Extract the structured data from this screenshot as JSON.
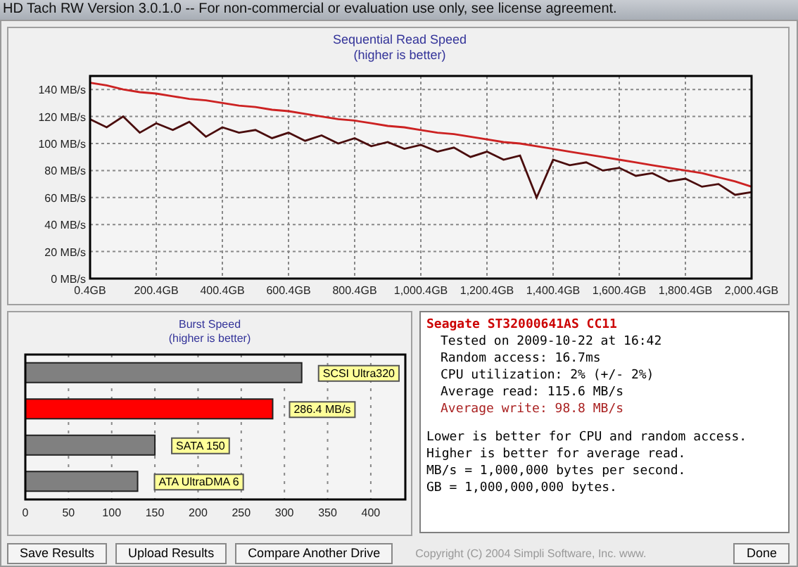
{
  "window": {
    "title": "HD Tach RW Version 3.0.1.0 -- For non-commercial or evaluation use only, see license agreement."
  },
  "sequential_chart": {
    "chart_data": {
      "type": "line",
      "title": "Sequential Read Speed",
      "subtitle": "(higher is better)",
      "x": [
        0.4,
        50.4,
        100.4,
        150.4,
        200.4,
        250.4,
        300.4,
        350.4,
        400.4,
        450.4,
        500.4,
        550.4,
        600.4,
        650.4,
        700.4,
        750.4,
        800.4,
        850.4,
        900.4,
        950.4,
        1000.4,
        1050.4,
        1100.4,
        1150.4,
        1200.4,
        1250.4,
        1300.4,
        1350.4,
        1400.4,
        1450.4,
        1500.4,
        1550.4,
        1600.4,
        1650.4,
        1700.4,
        1750.4,
        1800.4,
        1850.4,
        1900.4,
        1950.4,
        2000.4
      ],
      "series": [
        {
          "color": "#cc2222",
          "values": [
            145,
            143,
            140,
            138,
            137,
            135,
            133,
            132,
            130,
            128,
            127,
            125,
            124,
            122,
            120,
            118,
            117,
            115,
            113,
            112,
            110,
            108,
            107,
            105,
            103,
            101,
            100,
            98,
            96,
            94,
            92,
            90,
            88,
            86,
            84,
            82,
            80,
            78,
            75,
            72,
            68
          ]
        },
        {
          "color": "#4a0d0d",
          "values": [
            118,
            112,
            120,
            108,
            115,
            110,
            116,
            105,
            112,
            108,
            110,
            104,
            108,
            102,
            106,
            100,
            104,
            98,
            101,
            96,
            99,
            94,
            97,
            90,
            94,
            88,
            91,
            60,
            88,
            84,
            86,
            80,
            82,
            76,
            78,
            72,
            74,
            68,
            70,
            62,
            64
          ]
        }
      ],
      "xlim": [
        0.4,
        2000.4
      ],
      "ylim": [
        0,
        150
      ],
      "grid": true,
      "xticks": [
        {
          "value": 0.4,
          "label": "0.4GB"
        },
        {
          "value": 200.4,
          "label": "200.4GB"
        },
        {
          "value": 400.4,
          "label": "400.4GB"
        },
        {
          "value": 600.4,
          "label": "600.4GB"
        },
        {
          "value": 800.4,
          "label": "800.4GB"
        },
        {
          "value": 1000.4,
          "label": "1,000.4GB"
        },
        {
          "value": 1200.4,
          "label": "1,200.4GB"
        },
        {
          "value": 1400.4,
          "label": "1,400.4GB"
        },
        {
          "value": 1600.4,
          "label": "1,600.4GB"
        },
        {
          "value": 1800.4,
          "label": "1,800.4GB"
        },
        {
          "value": 2000.4,
          "label": "2,000.4GB"
        }
      ],
      "yticks": [
        {
          "value": 0,
          "label": "0 MB/s"
        },
        {
          "value": 20,
          "label": "20 MB/s"
        },
        {
          "value": 40,
          "label": "40 MB/s"
        },
        {
          "value": 60,
          "label": "60 MB/s"
        },
        {
          "value": 80,
          "label": "80 MB/s"
        },
        {
          "value": 100,
          "label": "100 MB/s"
        },
        {
          "value": 120,
          "label": "120 MB/s"
        },
        {
          "value": 140,
          "label": "140 MB/s"
        }
      ]
    }
  },
  "burst_chart": {
    "chart_data": {
      "type": "bar",
      "orientation": "horizontal",
      "title": "Burst Speed",
      "subtitle": "(higher is better)",
      "categories": [
        "SCSI Ultra320",
        "286.4 MB/s",
        "SATA 150",
        "ATA UltraDMA 6"
      ],
      "series": [
        {
          "color": "#808080",
          "values": [
            320,
            null,
            150,
            130
          ]
        },
        {
          "color": "#ff0000",
          "values": [
            null,
            286.4,
            null,
            null
          ]
        }
      ],
      "xlim": [
        0,
        440
      ],
      "grid": true,
      "xticks": [
        0,
        50,
        100,
        150,
        200,
        250,
        300,
        350,
        400
      ]
    }
  },
  "results": {
    "lines": [
      {
        "text": "Seagate ST32000641AS CC11",
        "color": "#cc0000",
        "bold": true
      },
      {
        "text": "Tested on 2009-10-22 at 16:42",
        "color": "#000000",
        "bold": false
      },
      {
        "text": "Random access: 16.7ms",
        "color": "#000000",
        "bold": false
      },
      {
        "text": "CPU utilization: 2% (+/- 2%)",
        "color": "#000000",
        "bold": false
      },
      {
        "text": "Average read: 115.6 MB/s",
        "color": "#000000",
        "bold": false
      },
      {
        "text": "Average write: 98.8 MB/s",
        "color": "#aa2222",
        "bold": false
      }
    ],
    "notes": [
      "Lower is better for CPU and random access.",
      "Higher is better for average read.",
      "MB/s = 1,000,000 bytes per second.",
      "GB = 1,000,000,000 bytes."
    ]
  },
  "buttons": [
    "Save Results",
    "Upload Results",
    "Compare Another Drive"
  ],
  "copyright": "Copyright (C) 2004 Simpli Software, Inc. www.",
  "done_button": "Done"
}
